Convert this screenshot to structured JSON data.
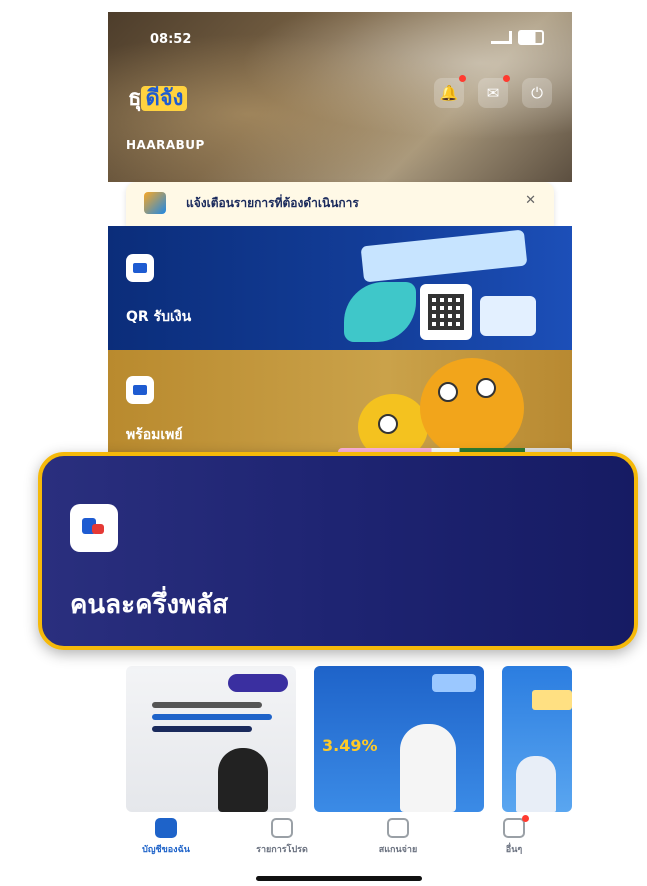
{
  "status": {
    "time": "08:52"
  },
  "header": {
    "logo_prefix": "ธุ",
    "logo_accent": "ดีจัง",
    "greeting": "HAARABUP",
    "icons": [
      "bell-icon",
      "mail-icon",
      "logout-icon"
    ]
  },
  "notice": {
    "text": "แจ้งเตือนรายการที่ต้องดำเนินการ",
    "close": "✕"
  },
  "cards": [
    {
      "label": "QR รับเงิน",
      "icon": "qr-card-icon"
    },
    {
      "label": "พร้อมเพย์",
      "icon": "wallet-card-icon"
    }
  ],
  "highlight": {
    "label": "คนละครึ่งพลัส",
    "icon": "paotang-icon"
  },
  "promos": [
    {
      "num": ""
    },
    {
      "num": "3.49%"
    },
    {
      "num": ""
    }
  ],
  "nav": [
    {
      "label": "บัญชีของฉัน",
      "icon": "home-icon",
      "active": true
    },
    {
      "label": "รายการโปรด",
      "icon": "favorite-icon",
      "active": false
    },
    {
      "label": "สแกนจ่าย",
      "icon": "scan-icon",
      "active": false
    },
    {
      "label": "อื่นๆ",
      "icon": "more-icon",
      "active": false
    }
  ],
  "colors": {
    "accent": "#f5b90a",
    "highlight_bg": "#1e2472",
    "qr_bg": "#133e9a",
    "pet_bg": "#caa24a",
    "active_nav": "#1e63c9"
  }
}
